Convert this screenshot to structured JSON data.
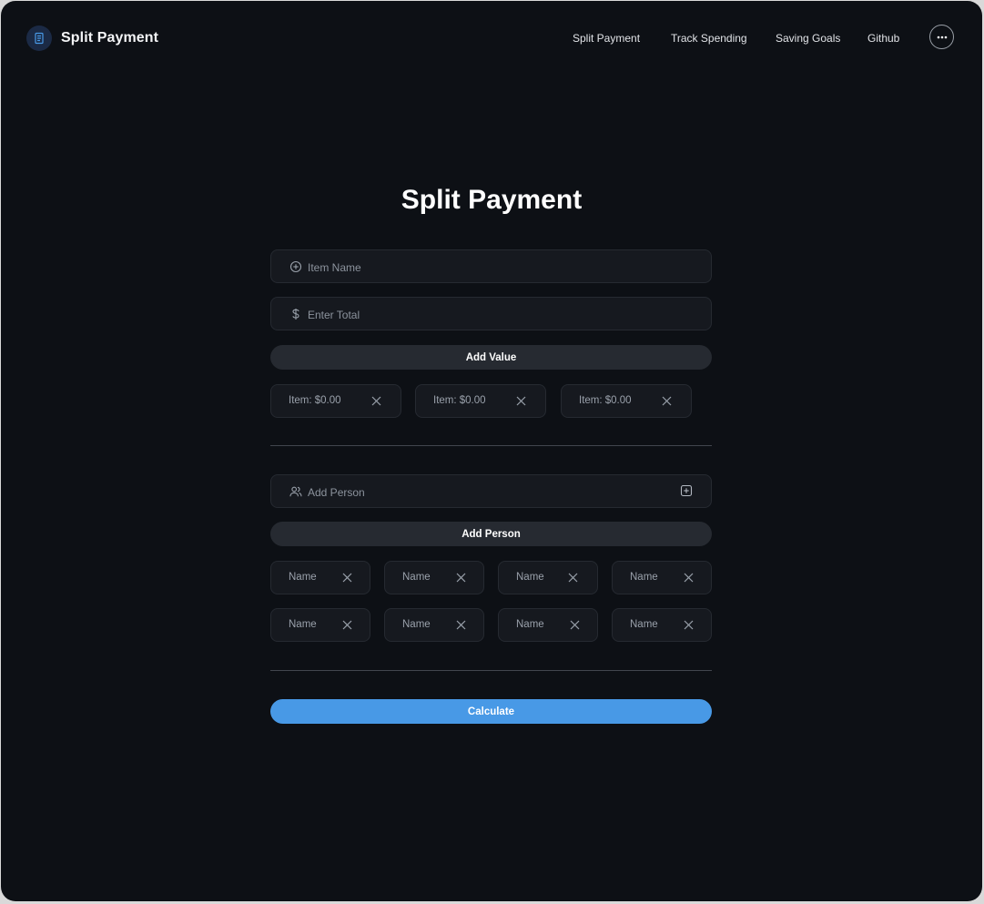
{
  "header": {
    "brand_name": "Split Payment",
    "nav": [
      "Split Payment",
      "Track Spending",
      "Saving Goals",
      "Github"
    ]
  },
  "main": {
    "title": "Split Payment",
    "item_name_placeholder": "Item Name",
    "total_placeholder": "Enter Total",
    "add_value_label": "Add Value",
    "items": [
      "Item: $0.00",
      "Item: $0.00",
      "Item: $0.00"
    ],
    "person_placeholder": "Add Person",
    "add_person_label": "Add Person",
    "people": [
      "Name",
      "Name",
      "Name",
      "Name",
      "Name",
      "Name",
      "Name",
      "Name"
    ],
    "calculate_label": "Calculate"
  },
  "colors": {
    "background": "#0d1015",
    "field": "#16191f",
    "button_dark": "#262a31",
    "accent": "#4899e6"
  },
  "icons": [
    "receipt-icon",
    "more-horizontal-icon",
    "plus-circle-icon",
    "dollar-icon",
    "close-icon",
    "users-icon",
    "plus-square-icon"
  ]
}
